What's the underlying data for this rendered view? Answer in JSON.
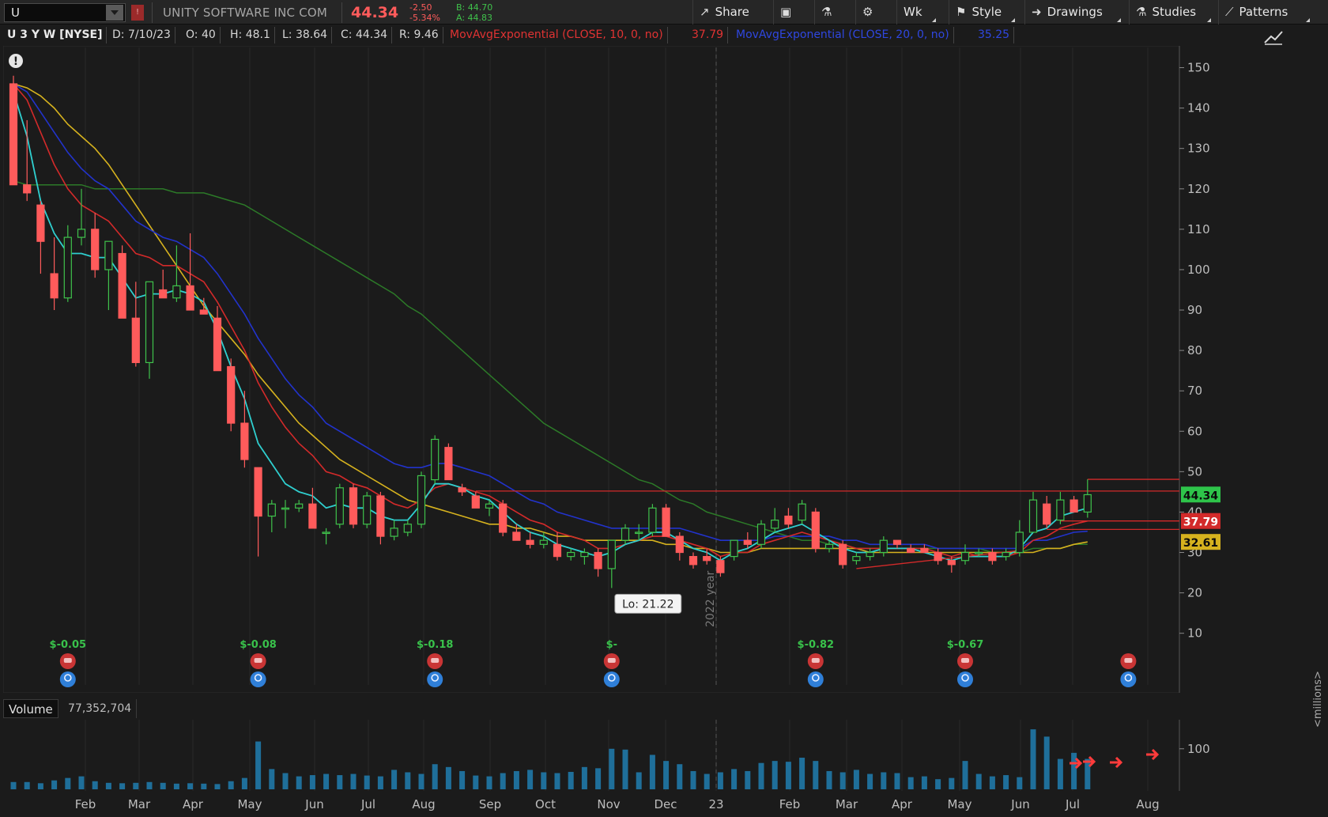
{
  "toolbar": {
    "symbol": "U",
    "flag": "!",
    "company": "UNITY SOFTWARE INC COM",
    "last": "44.34",
    "change_abs": "-2.50",
    "change_pct": "-5.34%",
    "bid": "B: 44.70",
    "ask": "A: 44.83",
    "share_label": "Share",
    "timeframe_label": "Wk",
    "style_label": "Style",
    "drawings_label": "Drawings",
    "studies_label": "Studies",
    "patterns_label": "Patterns"
  },
  "infobar": {
    "symbol": "U 3 Y W [NYSE]",
    "date": "D: 7/10/23",
    "open": "O: 40",
    "high": "H: 48.1",
    "low": "L: 38.64",
    "close": "C: 44.34",
    "range": "R: 9.46",
    "ema10_label": "MovAvgExponential (CLOSE, 10, 0, no)",
    "ema10_value": "37.79",
    "ema20_label": "MovAvgExponential (CLOSE, 20, 0, no)",
    "ema20_value": "35.25"
  },
  "colors": {
    "up": "#3fc24b",
    "down": "#ff5b5b",
    "ema10": "#d32a2a",
    "ema20": "#2233cc",
    "ema_fast": "#2fcfcf",
    "sma_yellow": "#d6b21e",
    "sma_green": "#2c7a28",
    "volume": "#1f6f9a",
    "background": "#1b1b1b"
  },
  "chart_data": {
    "type": "candlestick",
    "y_axis_ticks": [
      "150",
      "140",
      "130",
      "120",
      "110",
      "100",
      "90",
      "80",
      "70",
      "60",
      "50",
      "40",
      "30",
      "20",
      "10"
    ],
    "ylim": [
      7,
      155
    ],
    "x_axis_ticks": [
      "Feb",
      "Mar",
      "Apr",
      "May",
      "Jun",
      "Jul",
      "Aug",
      "Sep",
      "Oct",
      "Nov",
      "Dec",
      "23",
      "Feb",
      "Mar",
      "Apr",
      "May",
      "Jun",
      "Jul",
      "Aug"
    ],
    "year_marker": "2022 year",
    "candles": [
      {
        "o": 146,
        "h": 148,
        "l": 121,
        "c": 121
      },
      {
        "o": 121,
        "h": 137,
        "l": 117,
        "c": 119
      },
      {
        "o": 116,
        "h": 117,
        "l": 99,
        "c": 107
      },
      {
        "o": 99,
        "h": 108,
        "l": 90,
        "c": 93
      },
      {
        "o": 93,
        "h": 111,
        "l": 92,
        "c": 108
      },
      {
        "o": 108,
        "h": 120,
        "l": 106,
        "c": 110
      },
      {
        "o": 110,
        "h": 114,
        "l": 98,
        "c": 100
      },
      {
        "o": 100,
        "h": 107,
        "l": 90,
        "c": 107
      },
      {
        "o": 104,
        "h": 106,
        "l": 88,
        "c": 88
      },
      {
        "o": 88,
        "h": 97,
        "l": 76,
        "c": 77
      },
      {
        "o": 77,
        "h": 97,
        "l": 73,
        "c": 97
      },
      {
        "o": 95,
        "h": 100,
        "l": 93,
        "c": 93
      },
      {
        "o": 93,
        "h": 106,
        "l": 92,
        "c": 96
      },
      {
        "o": 96,
        "h": 109,
        "l": 90,
        "c": 90
      },
      {
        "o": 90,
        "h": 93,
        "l": 89,
        "c": 89
      },
      {
        "o": 88,
        "h": 91,
        "l": 75,
        "c": 75
      },
      {
        "o": 76,
        "h": 78,
        "l": 60,
        "c": 62
      },
      {
        "o": 62,
        "h": 70,
        "l": 51,
        "c": 53
      },
      {
        "o": 51,
        "h": 51,
        "l": 29,
        "c": 39
      },
      {
        "o": 39,
        "h": 43,
        "l": 35,
        "c": 42
      },
      {
        "o": 41,
        "h": 43,
        "l": 36,
        "c": 41
      },
      {
        "o": 41,
        "h": 43,
        "l": 40,
        "c": 42
      },
      {
        "o": 42,
        "h": 46,
        "l": 36,
        "c": 36
      },
      {
        "o": 35,
        "h": 36,
        "l": 32,
        "c": 35
      },
      {
        "o": 37,
        "h": 47,
        "l": 36,
        "c": 46
      },
      {
        "o": 46,
        "h": 47,
        "l": 36,
        "c": 37
      },
      {
        "o": 37,
        "h": 45,
        "l": 36,
        "c": 44
      },
      {
        "o": 44,
        "h": 45,
        "l": 32,
        "c": 34
      },
      {
        "o": 34,
        "h": 38,
        "l": 33,
        "c": 36
      },
      {
        "o": 35,
        "h": 38,
        "l": 34,
        "c": 37
      },
      {
        "o": 37,
        "h": 50,
        "l": 36,
        "c": 49
      },
      {
        "o": 48,
        "h": 59,
        "l": 47,
        "c": 58
      },
      {
        "o": 56,
        "h": 57,
        "l": 48,
        "c": 48
      },
      {
        "o": 46,
        "h": 47,
        "l": 44,
        "c": 45
      },
      {
        "o": 44,
        "h": 45,
        "l": 41,
        "c": 41
      },
      {
        "o": 41,
        "h": 43,
        "l": 39,
        "c": 42
      },
      {
        "o": 42,
        "h": 43,
        "l": 34,
        "c": 35
      },
      {
        "o": 35,
        "h": 37,
        "l": 33,
        "c": 33
      },
      {
        "o": 33,
        "h": 35,
        "l": 31,
        "c": 32
      },
      {
        "o": 32,
        "h": 35,
        "l": 31,
        "c": 33
      },
      {
        "o": 32,
        "h": 35,
        "l": 28,
        "c": 29
      },
      {
        "o": 29,
        "h": 31,
        "l": 28,
        "c": 30
      },
      {
        "o": 29,
        "h": 31,
        "l": 27,
        "c": 30
      },
      {
        "o": 30,
        "h": 31,
        "l": 24,
        "c": 26
      },
      {
        "o": 26,
        "h": 33,
        "l": 21.2,
        "c": 33
      },
      {
        "o": 33,
        "h": 37,
        "l": 32,
        "c": 36
      },
      {
        "o": 35,
        "h": 37,
        "l": 33,
        "c": 35
      },
      {
        "o": 35,
        "h": 42,
        "l": 34,
        "c": 41
      },
      {
        "o": 41,
        "h": 42,
        "l": 34,
        "c": 34
      },
      {
        "o": 34,
        "h": 35,
        "l": 28,
        "c": 30
      },
      {
        "o": 29,
        "h": 30,
        "l": 26,
        "c": 27
      },
      {
        "o": 29,
        "h": 31,
        "l": 27,
        "c": 28
      },
      {
        "o": 28,
        "h": 29,
        "l": 24,
        "c": 25
      },
      {
        "o": 29,
        "h": 33,
        "l": 28,
        "c": 33
      },
      {
        "o": 33,
        "h": 35,
        "l": 31,
        "c": 32
      },
      {
        "o": 32,
        "h": 38,
        "l": 31,
        "c": 37
      },
      {
        "o": 36,
        "h": 41,
        "l": 35,
        "c": 38
      },
      {
        "o": 39,
        "h": 41,
        "l": 36,
        "c": 37
      },
      {
        "o": 38,
        "h": 43,
        "l": 37,
        "c": 42
      },
      {
        "o": 40,
        "h": 41,
        "l": 30,
        "c": 31
      },
      {
        "o": 31,
        "h": 33,
        "l": 30,
        "c": 32
      },
      {
        "o": 32,
        "h": 33,
        "l": 26,
        "c": 27
      },
      {
        "o": 28,
        "h": 30,
        "l": 27,
        "c": 29
      },
      {
        "o": 29,
        "h": 31,
        "l": 28,
        "c": 30
      },
      {
        "o": 30,
        "h": 34,
        "l": 29,
        "c": 33
      },
      {
        "o": 33,
        "h": 33,
        "l": 31,
        "c": 32
      },
      {
        "o": 31,
        "h": 32,
        "l": 30,
        "c": 30
      },
      {
        "o": 31,
        "h": 32,
        "l": 30,
        "c": 30
      },
      {
        "o": 30,
        "h": 31,
        "l": 27,
        "c": 28
      },
      {
        "o": 28,
        "h": 29,
        "l": 25,
        "c": 27
      },
      {
        "o": 28,
        "h": 32,
        "l": 27,
        "c": 30
      },
      {
        "o": 30,
        "h": 31,
        "l": 29,
        "c": 30
      },
      {
        "o": 30,
        "h": 31,
        "l": 27,
        "c": 28
      },
      {
        "o": 29,
        "h": 31,
        "l": 28,
        "c": 30
      },
      {
        "o": 30,
        "h": 38,
        "l": 29,
        "c": 35
      },
      {
        "o": 35,
        "h": 45,
        "l": 35,
        "c": 43
      },
      {
        "o": 42,
        "h": 44,
        "l": 36,
        "c": 37
      },
      {
        "o": 38,
        "h": 45,
        "l": 37,
        "c": 43
      },
      {
        "o": 43,
        "h": 44,
        "l": 40,
        "c": 40
      },
      {
        "o": 40,
        "h": 48.1,
        "l": 38.6,
        "c": 44.3
      }
    ],
    "ema_fast_line": [
      144,
      133,
      117,
      109,
      104,
      104,
      103,
      103,
      98,
      93,
      94,
      94,
      95,
      94,
      92,
      85,
      76,
      68,
      57,
      52,
      47,
      45,
      44,
      41,
      42,
      41,
      41,
      39,
      38,
      38,
      42,
      47,
      47,
      46,
      44,
      43,
      40,
      37,
      35,
      34,
      32,
      31,
      30,
      29,
      30,
      32,
      33,
      35,
      35,
      33,
      31,
      30,
      28,
      30,
      31,
      33,
      35,
      36,
      37,
      35,
      33,
      31,
      30,
      30,
      31,
      31,
      31,
      30,
      29,
      28,
      29,
      29,
      29,
      29,
      31,
      35,
      36,
      39,
      40,
      41
    ],
    "ema10_line": [
      146,
      142,
      134,
      126,
      120,
      116,
      114,
      112,
      108,
      104,
      103,
      101,
      101,
      99,
      97,
      92,
      86,
      80,
      72,
      66,
      61,
      57,
      54,
      50,
      49,
      47,
      46,
      44,
      42,
      41,
      43,
      46,
      47,
      46,
      45,
      44,
      42,
      40,
      38,
      37,
      35,
      34,
      33,
      31,
      31,
      32,
      33,
      34,
      34,
      33,
      32,
      31,
      29,
      30,
      30,
      32,
      33,
      34,
      35,
      34,
      33,
      32,
      31,
      31,
      31,
      31,
      31,
      31,
      30,
      29,
      30,
      29,
      29,
      29,
      30,
      33,
      34,
      36,
      37,
      37.8
    ],
    "ema20_line": [
      146,
      144,
      139,
      134,
      129,
      125,
      122,
      120,
      116,
      112,
      110,
      108,
      107,
      105,
      103,
      99,
      94,
      89,
      83,
      78,
      73,
      69,
      66,
      62,
      60,
      58,
      56,
      54,
      52,
      51,
      51,
      52,
      52,
      51,
      50,
      49,
      47,
      45,
      43,
      42,
      40,
      39,
      38,
      37,
      36,
      36,
      36,
      36,
      36,
      36,
      35,
      34,
      33,
      33,
      33,
      33,
      34,
      34,
      34,
      34,
      34,
      33,
      33,
      32,
      32,
      32,
      32,
      32,
      31,
      31,
      31,
      31,
      31,
      31,
      31,
      33,
      33,
      34,
      35,
      35.25
    ],
    "sma_yellow_line": [
      146,
      145,
      143,
      140,
      136,
      133,
      130,
      126,
      121,
      116,
      111,
      106,
      101,
      96,
      91,
      87,
      83,
      79,
      74,
      70,
      66,
      62,
      59,
      56,
      53,
      51,
      49,
      47,
      45,
      43,
      42,
      41,
      40,
      39,
      38,
      37,
      37,
      36,
      36,
      35,
      34,
      34,
      33,
      33,
      33,
      33,
      33,
      33,
      32,
      32,
      31,
      31,
      30,
      30,
      30,
      31,
      31,
      31,
      31,
      31,
      31,
      31,
      31,
      30,
      30,
      30,
      30,
      30,
      30,
      30,
      30,
      30,
      30,
      30,
      30,
      30,
      31,
      31,
      32,
      32.61
    ],
    "sma_green_line": [
      122,
      121,
      121,
      121,
      121,
      121,
      120,
      120,
      120,
      120,
      120,
      120,
      119,
      119,
      119,
      118,
      117,
      116,
      114,
      112,
      110,
      108,
      106,
      104,
      102,
      100,
      98,
      96,
      94,
      91,
      89,
      86,
      83,
      80,
      77,
      74,
      71,
      68,
      65,
      62,
      60,
      58,
      56,
      54,
      52,
      50,
      48,
      47,
      45,
      43,
      42,
      40,
      39,
      38,
      37,
      36,
      35,
      34,
      33,
      33,
      32,
      32,
      31,
      31,
      31,
      31,
      31,
      31,
      31,
      31,
      31,
      31,
      30,
      30,
      30,
      31,
      31,
      31,
      32,
      32
    ],
    "horizontal_levels": [
      {
        "price": 48.1,
        "color": "#d32a2a"
      },
      {
        "price": 45.2,
        "color": "#d32a2a"
      },
      {
        "price": 37.8,
        "color": "#d32a2a"
      },
      {
        "price": 35.7,
        "color": "#d32a2a"
      }
    ],
    "price_tags": [
      {
        "label": "44.34",
        "price": 44.34,
        "bg": "#2ec44a",
        "fg": "#0b0b0b"
      },
      {
        "label": "37.79",
        "price": 37.79,
        "bg": "#d32a2a",
        "fg": "#ffffff"
      },
      {
        "label": "32.61",
        "price": 32.61,
        "bg": "#d6b21e",
        "fg": "#0b0b0b"
      }
    ],
    "low_callout": "Lo: 21.22",
    "earnings": [
      {
        "bar": 4,
        "label": "$-0.05"
      },
      {
        "bar": 18,
        "label": "$-0.08"
      },
      {
        "bar": 31,
        "label": "$-0.18"
      },
      {
        "bar": 44,
        "label": "$-"
      },
      {
        "bar": 59,
        "label": "$-0.82"
      },
      {
        "bar": 70,
        "label": "$-0.67"
      },
      {
        "bar": 82,
        "label": ""
      }
    ],
    "volume_header": {
      "label": "Volume",
      "value": "77,352,704"
    },
    "volume_ticks": [
      "100"
    ],
    "volume_unit": "<millions>",
    "volume_millions": [
      18,
      18,
      15,
      22,
      28,
      32,
      20,
      16,
      15,
      16,
      18,
      16,
      14,
      15,
      14,
      13,
      20,
      28,
      118,
      50,
      40,
      32,
      35,
      38,
      35,
      38,
      34,
      32,
      48,
      42,
      38,
      62,
      55,
      45,
      34,
      32,
      40,
      45,
      48,
      42,
      40,
      43,
      55,
      52,
      100,
      98,
      42,
      85,
      70,
      62,
      45,
      38,
      42,
      50,
      45,
      65,
      70,
      68,
      78,
      70,
      45,
      42,
      48,
      38,
      42,
      40,
      30,
      32,
      25,
      28,
      70,
      38,
      32,
      35,
      30,
      148,
      130,
      75,
      90,
      75
    ]
  }
}
